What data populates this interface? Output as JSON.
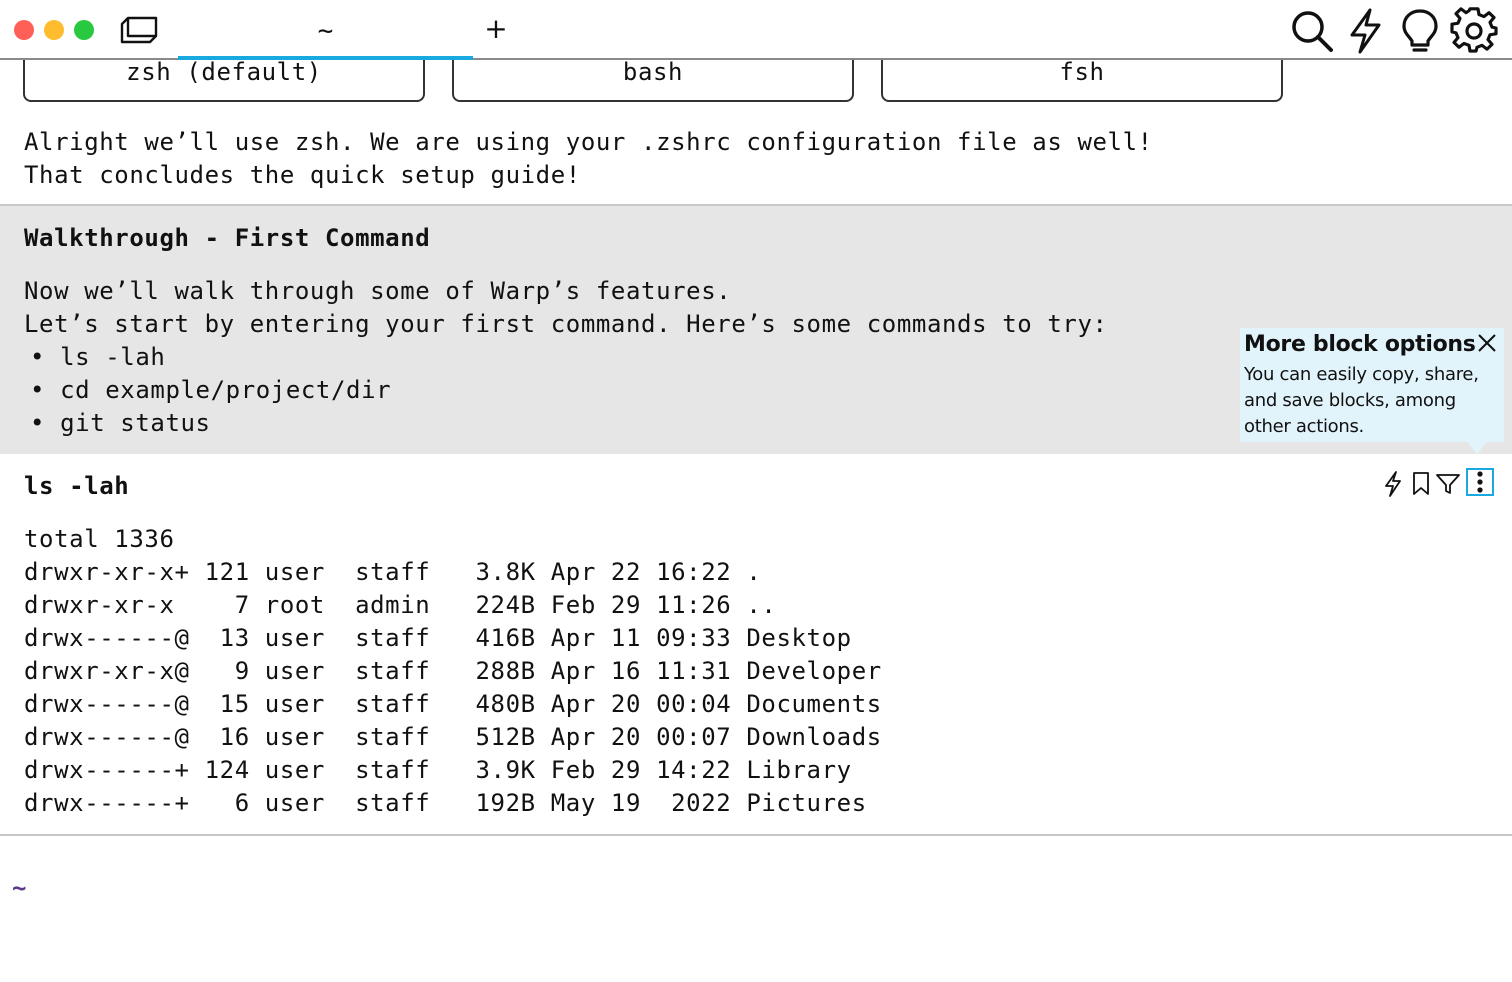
{
  "window": {
    "active_tab_label": "~",
    "new_tab_label": "+",
    "toolbar_icons": [
      "search-icon",
      "lightning-icon",
      "lightbulb-icon",
      "gear-icon"
    ]
  },
  "shell_options": [
    "zsh (default)",
    "bash",
    "fsh"
  ],
  "setup_output": {
    "line1": "Alright we’ll use zsh. We are using your .zshrc configuration file as well!",
    "line2": "That concludes the quick setup guide!"
  },
  "walkthrough": {
    "title": "Walkthrough - First Command",
    "line1": "Now we’ll walk through some of Warp’s features.",
    "line2": "Let’s start by entering your first command. Here’s some commands to try:",
    "commands": [
      "• ls -lah",
      "• cd example/project/dir",
      "• git status"
    ]
  },
  "tooltip": {
    "title": "More block options",
    "body": "You can easily copy, share, and save blocks, among other actions."
  },
  "command_block": {
    "command": "ls -lah",
    "icons": [
      "lightning-icon",
      "bookmark-icon",
      "filter-icon",
      "more-options-icon"
    ],
    "output": [
      "total 1336",
      "drwxr-xr-x+ 121 user  staff   3.8K Apr 22 16:22 .",
      "drwxr-xr-x    7 root  admin   224B Feb 29 11:26 ..",
      "drwx------@  13 user  staff   416B Apr 11 09:33 Desktop",
      "drwxr-xr-x@   9 user  staff   288B Apr 16 11:31 Developer",
      "drwx------@  15 user  staff   480B Apr 20 00:04 Documents",
      "drwx------@  16 user  staff   512B Apr 20 00:07 Downloads",
      "drwx------+ 124 user  staff   3.9K Feb 29 14:22 Library",
      "drwx------+   6 user  staff   192B May 19  2022 Pictures"
    ]
  },
  "prompt": {
    "text": "~"
  },
  "colors": {
    "accent": "#19a9e0",
    "walkthrough_bg": "#e6e6e6",
    "tooltip_bg": "#e2f4fb",
    "prompt": "#5b3a8c"
  }
}
